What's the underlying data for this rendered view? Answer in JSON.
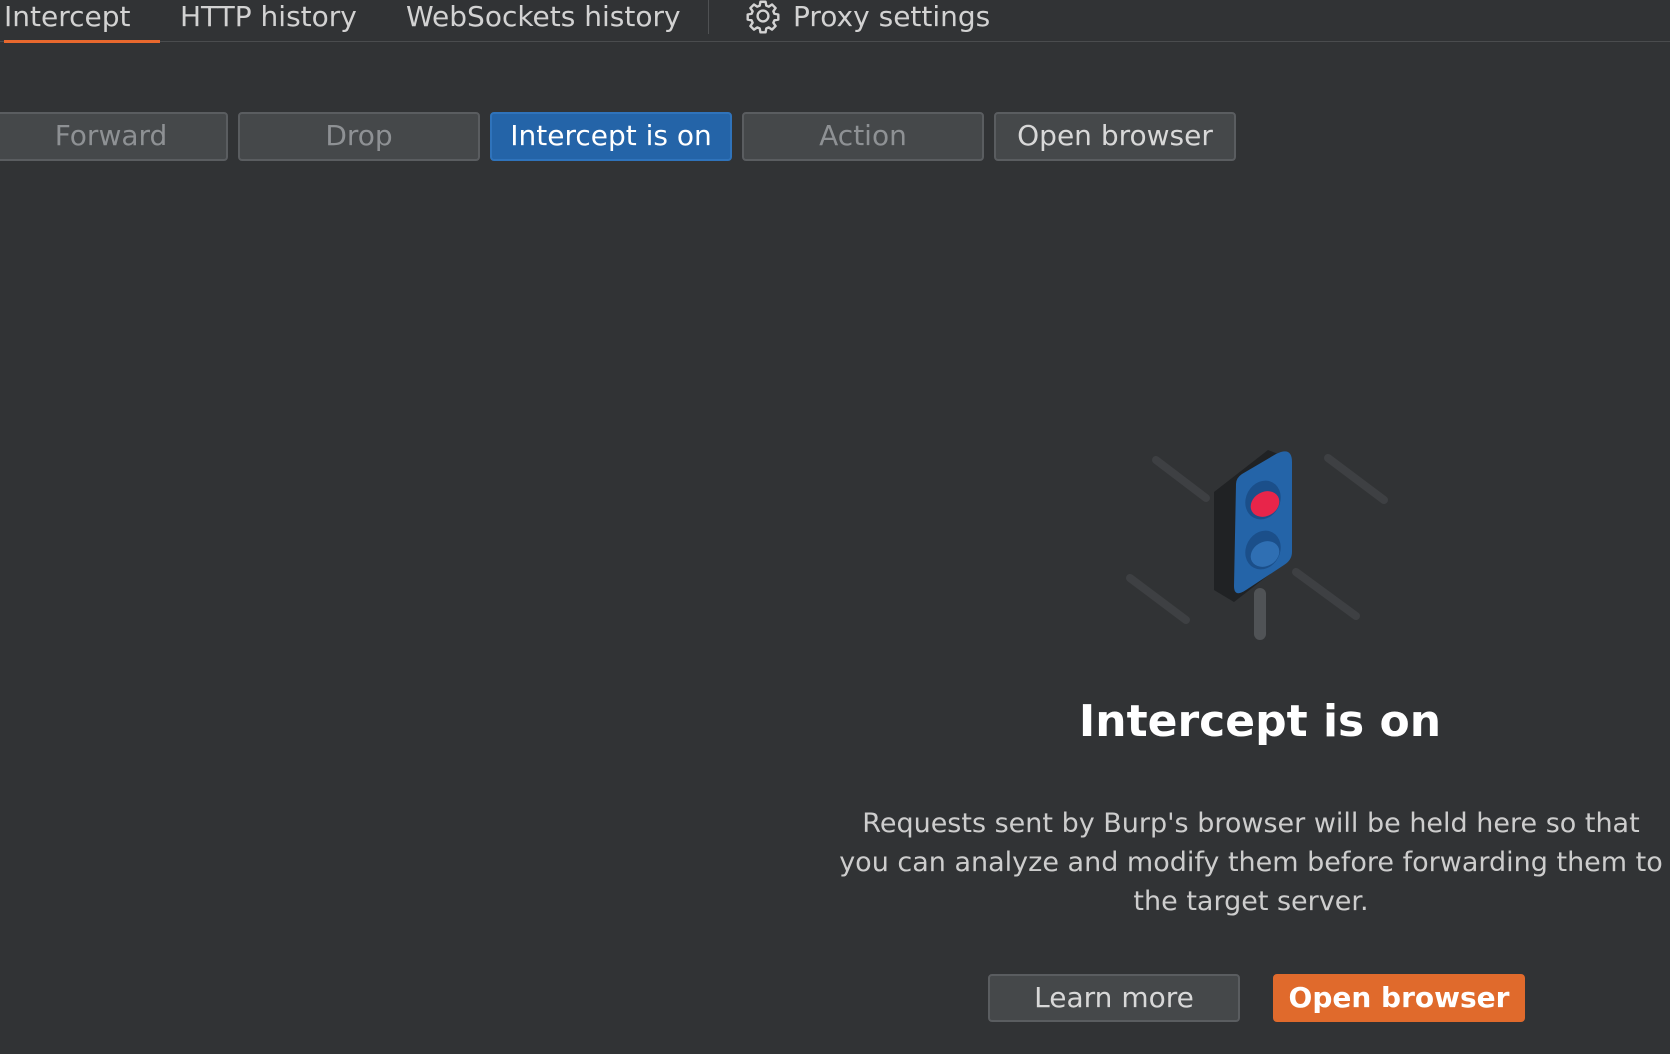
{
  "tabs": [
    {
      "label": "Intercept",
      "active": true
    },
    {
      "label": "HTTP history",
      "active": false
    },
    {
      "label": "WebSockets history",
      "active": false
    }
  ],
  "settings_tab": {
    "label": "Proxy settings",
    "icon": "gear-icon"
  },
  "toolbar": {
    "forward_label": "Forward",
    "drop_label": "Drop",
    "intercept_label": "Intercept is on",
    "action_label": "Action",
    "open_browser_label": "Open browser"
  },
  "empty_state": {
    "icon": "traffic-light-icon",
    "title": "Intercept is on",
    "description": "Requests sent by Burp's browser will be held here so that you can analyze and modify them before forwarding them to the target server.",
    "learn_more_label": "Learn more",
    "open_browser_label": "Open browser"
  },
  "colors": {
    "background": "#313335",
    "accent_orange": "#e06a2c",
    "primary_blue": "#2464a8",
    "tab_underline": "#e8682e",
    "light_red": "#e8254a"
  }
}
